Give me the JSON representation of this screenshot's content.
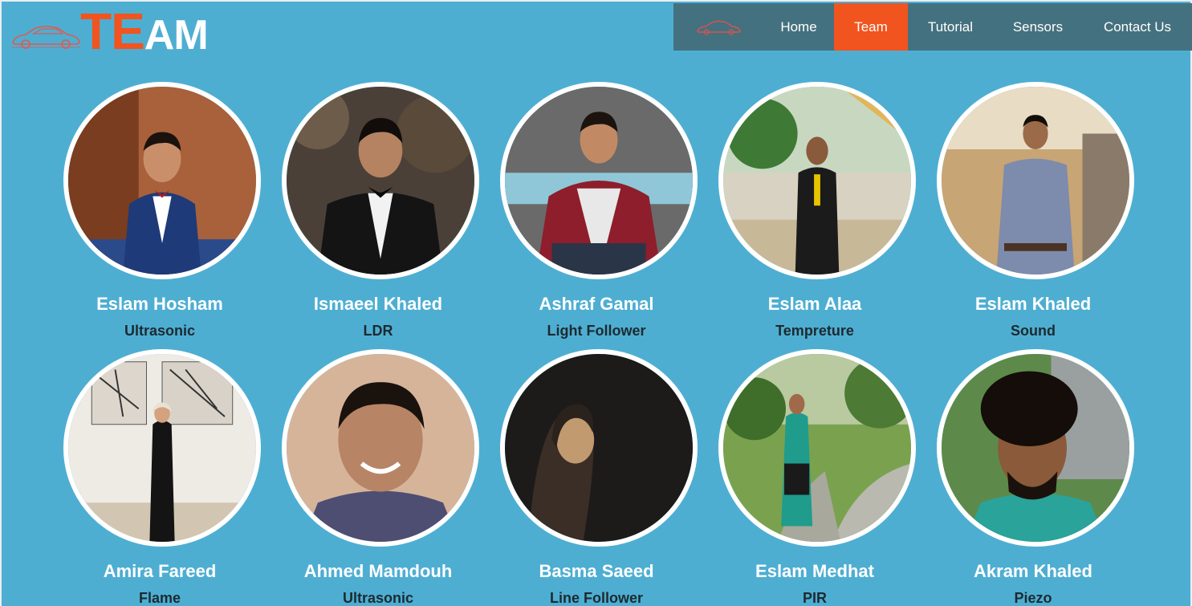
{
  "logo": {
    "part1": "TE",
    "part2": "AM"
  },
  "nav": {
    "items": [
      {
        "label": "Home"
      },
      {
        "label": "Team"
      },
      {
        "label": "Tutorial"
      },
      {
        "label": "Sensors"
      },
      {
        "label": "Contact Us"
      }
    ],
    "active": "Team"
  },
  "colors": {
    "background": "#4eaed2",
    "navbar": "#44717f",
    "accent": "#f1541e"
  },
  "team": [
    {
      "name": "Eslam Hosham",
      "role": "Ultrasonic"
    },
    {
      "name": "Ismaeel Khaled",
      "role": "LDR"
    },
    {
      "name": "Ashraf Gamal",
      "role": "Light Follower"
    },
    {
      "name": "Eslam Alaa",
      "role": "Tempreture"
    },
    {
      "name": "Eslam Khaled",
      "role": "Sound"
    },
    {
      "name": "Amira Fareed",
      "role": "Flame"
    },
    {
      "name": "Ahmed Mamdouh",
      "role": "Ultrasonic"
    },
    {
      "name": "Basma Saeed",
      "role": "Line Follower"
    },
    {
      "name": "Eslam Medhat",
      "role": "PIR"
    },
    {
      "name": "Akram Khaled",
      "role": "Piezo"
    }
  ]
}
